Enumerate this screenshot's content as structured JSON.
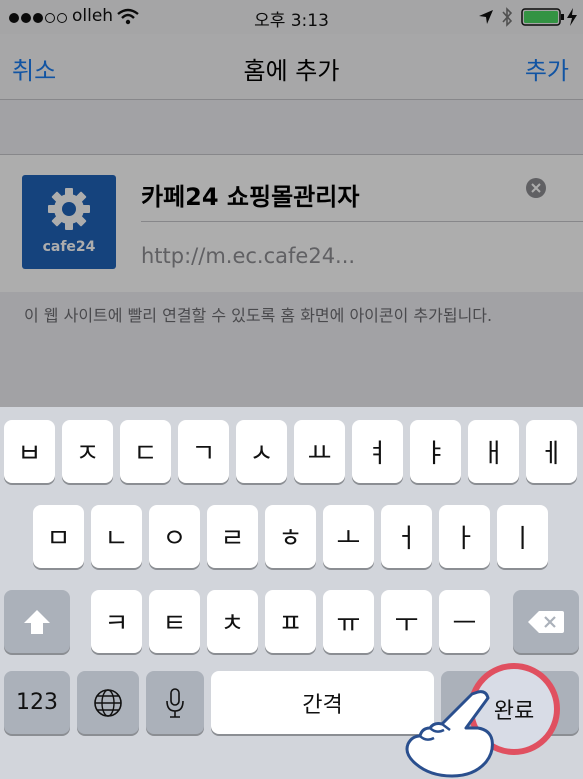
{
  "status_bar": {
    "carrier": "olleh",
    "time": "오후 3:13"
  },
  "nav": {
    "cancel_label": "취소",
    "title": "홈에 추가",
    "add_label": "추가"
  },
  "bookmark": {
    "app_name": "카페24 쇼핑몰관리자",
    "url": "http://m.ec.cafe24...",
    "icon_text": "cafe24"
  },
  "description": "이 웹 사이트에 빨리 연결할 수 있도록 홈 화면에 아이콘이 추가됩니다.",
  "keyboard": {
    "row1": [
      "ㅂ",
      "ㅈ",
      "ㄷ",
      "ㄱ",
      "ㅅ",
      "ㅛ",
      "ㅕ",
      "ㅑ",
      "ㅐ",
      "ㅔ"
    ],
    "row2": [
      "ㅁ",
      "ㄴ",
      "ㅇ",
      "ㄹ",
      "ㅎ",
      "ㅗ",
      "ㅓ",
      "ㅏ",
      "ㅣ"
    ],
    "row3": [
      "ㅋ",
      "ㅌ",
      "ㅊ",
      "ㅍ",
      "ㅠ",
      "ㅜ",
      "ㅡ"
    ],
    "numbers_label": "123",
    "space_label": "간격",
    "done_label": "완료"
  },
  "colors": {
    "accent": "#1a7cf0",
    "highlight_ring": "#e05060",
    "logo_blue": "#1f63b8"
  }
}
